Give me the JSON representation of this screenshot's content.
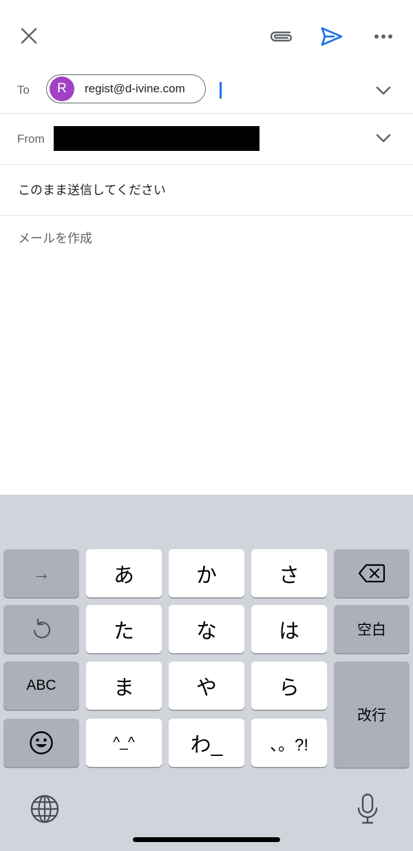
{
  "toolbar": {
    "close_icon": "close-icon",
    "attach_icon": "paperclip-icon",
    "send_icon": "send-icon",
    "more_icon": "more-horizontal-icon",
    "send_color": "#1a73e8"
  },
  "to_row": {
    "label": "To",
    "recipient": {
      "initial": "R",
      "email": "regist@d-ivine.com",
      "avatar_color": "#a142c4"
    }
  },
  "from_row": {
    "label": "From"
  },
  "subject": "このまま送信してください",
  "body_placeholder": "メールを作成",
  "keyboard": {
    "keys": {
      "arrow": "→",
      "a": "あ",
      "ka": "か",
      "sa": "さ",
      "ta": "た",
      "na": "な",
      "ha": "は",
      "space": "空白",
      "abc": "ABC",
      "ma": "ま",
      "ya": "や",
      "ra": "ら",
      "return": "改行",
      "kaomoji": "^_^",
      "wa": "わ_",
      "punct": "、。?!"
    }
  }
}
